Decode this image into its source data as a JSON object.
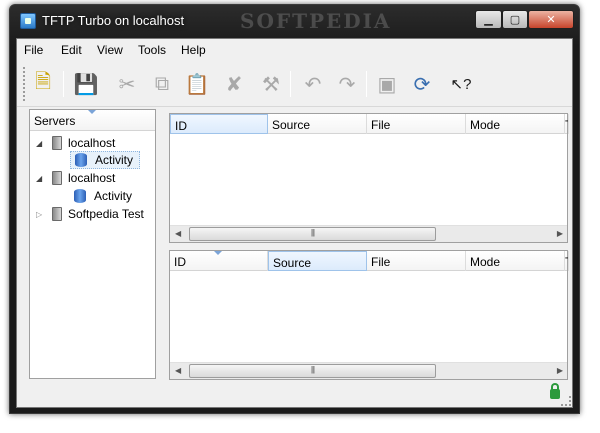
{
  "window": {
    "title": "TFTP Turbo on localhost",
    "watermark": "SOFTPEDIA"
  },
  "menu": {
    "items": [
      "File",
      "Edit",
      "View",
      "Tools",
      "Help"
    ]
  },
  "toolbar": {
    "buttons": [
      {
        "name": "new-icon",
        "glyph": "🗎"
      },
      {
        "name": "save-icon",
        "glyph": "💾"
      },
      {
        "name": "cut-icon",
        "glyph": "✂"
      },
      {
        "name": "copy-icon",
        "glyph": "⧉"
      },
      {
        "name": "paste-icon",
        "glyph": "📋"
      },
      {
        "name": "delete-icon",
        "glyph": "✘"
      },
      {
        "name": "tools-icon",
        "glyph": "⚒"
      },
      {
        "name": "undo-icon",
        "glyph": "↶"
      },
      {
        "name": "redo-icon",
        "glyph": "↷"
      },
      {
        "name": "preview-icon",
        "glyph": "▣"
      },
      {
        "name": "refresh-icon",
        "glyph": "⟳"
      },
      {
        "name": "help-cursor-icon",
        "glyph": "↖?"
      }
    ]
  },
  "servers": {
    "header": "Servers",
    "nodes": [
      {
        "label": "localhost",
        "expanded": true,
        "child": "Activity"
      },
      {
        "label": "localhost",
        "expanded": true,
        "child": "Activity"
      },
      {
        "label": "Softpedia Test",
        "expanded": false
      }
    ]
  },
  "lists": {
    "top_columns": [
      "ID",
      "Source",
      "File",
      "Mode",
      "T"
    ],
    "bottom_columns": [
      "ID",
      "Source",
      "File",
      "Mode",
      "T"
    ]
  },
  "colors": {
    "accent": "#3a6fb0",
    "selection": "#e8f2fb",
    "lock": "#2c9a3c"
  }
}
